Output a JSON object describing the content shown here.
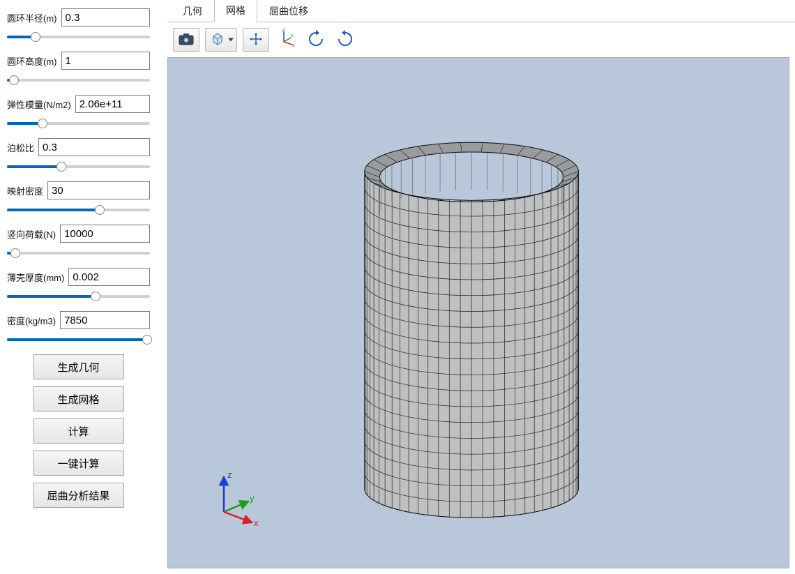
{
  "params": [
    {
      "label": "圆环半径(m)",
      "value": "0.3",
      "fill": 20,
      "thumb": 20
    },
    {
      "label": "圆环高度(m)",
      "value": "1",
      "fill": 5,
      "thumb": 5
    },
    {
      "label": "弹性模量(N/m2)",
      "value": "2.06e+11",
      "fill": 25,
      "thumb": 25
    },
    {
      "label": "泊松比",
      "value": "0.3",
      "fill": 38,
      "thumb": 38
    },
    {
      "label": "映射密度",
      "value": "30",
      "fill": 65,
      "thumb": 65
    },
    {
      "label": "竖向荷载(N)",
      "value": "10000",
      "fill": 6,
      "thumb": 6
    },
    {
      "label": "薄壳厚度(mm)",
      "value": "0.002",
      "fill": 62,
      "thumb": 62
    },
    {
      "label": "密度(kg/m3)",
      "value": "7850",
      "fill": 98,
      "thumb": 98
    }
  ],
  "buttons": {
    "gen_geom": "生成几何",
    "gen_mesh": "生成网格",
    "compute": "计算",
    "one_click": "一键计算",
    "buckling_result": "屈曲分析结果"
  },
  "tabs": [
    {
      "label": "几何",
      "active": false
    },
    {
      "label": "网格",
      "active": true
    },
    {
      "label": "屈曲位移",
      "active": false
    }
  ],
  "toolbar_icons": {
    "camera": "camera-icon",
    "cube": "cube-icon",
    "move": "move-icon",
    "axes": "axes-icon",
    "rotate_ccw": "rotate-ccw-icon",
    "rotate_cw": "rotate-cw-icon"
  },
  "triad": {
    "x": "x",
    "y": "y",
    "z": "z"
  },
  "colors": {
    "viewport_bg": "#b9c7db",
    "accent": "#0067c0",
    "axis_x": "#d62222",
    "axis_y": "#1a9e1a",
    "axis_z": "#1a3fd4"
  },
  "mesh": {
    "radial_segments": 30,
    "height_segments": 20
  }
}
